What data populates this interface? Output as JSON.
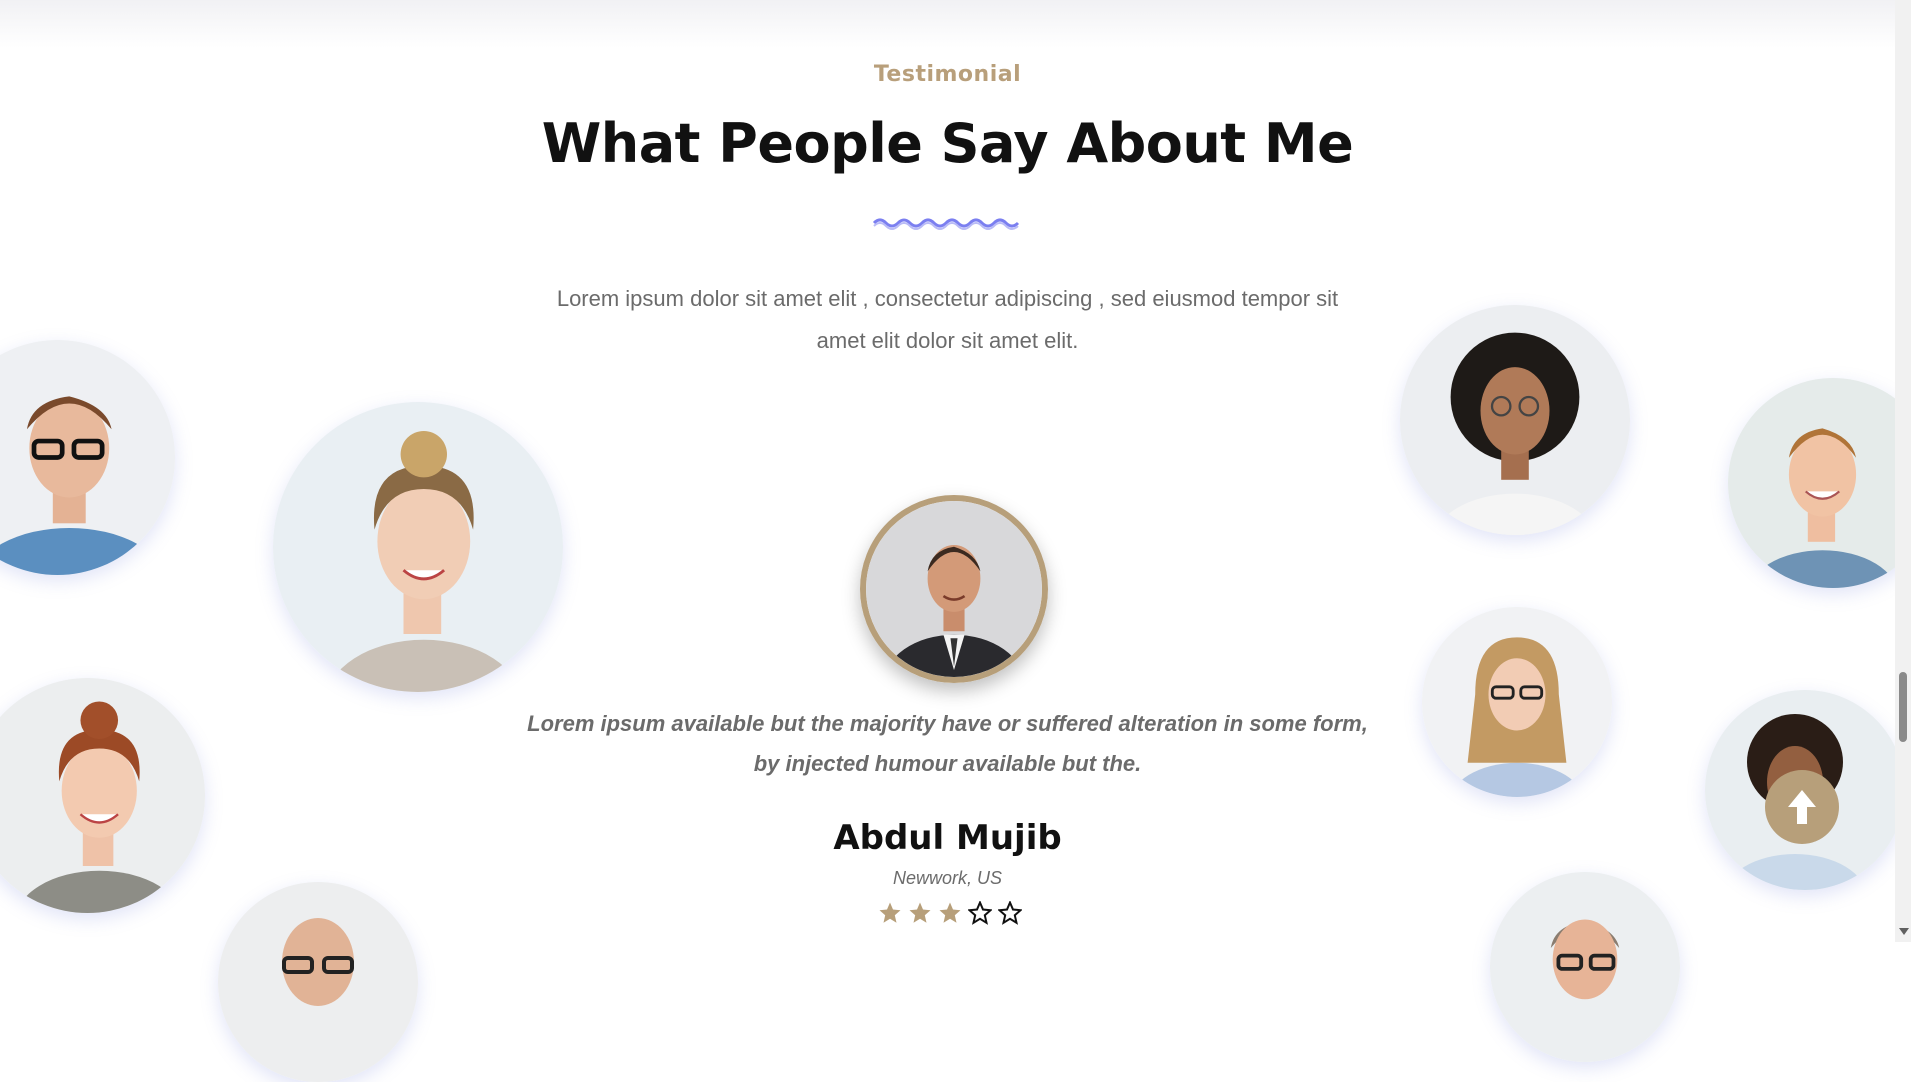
{
  "section": {
    "eyebrow": "Testimonial",
    "title": "What People Say About Me",
    "intro": "Lorem ipsum dolor sit amet elit , consectetur adipiscing , sed eiusmod tempor sit amet elit dolor sit amet elit."
  },
  "testimonial": {
    "quote": "Lorem ipsum available but the majority have or suffered alteration in some form, by injected humour available but the.",
    "name": "Abdul Mujib",
    "location": "Newwork, US",
    "rating": 3,
    "rating_max": 5
  },
  "colors": {
    "accent": "#b79f7a",
    "wave": "#7b7ff0",
    "title": "#111111",
    "body_text": "#6b6b6b"
  },
  "icons": {
    "scroll_top": "arrow-up-icon",
    "star_filled": "star-filled-icon",
    "star_empty": "star-outline-icon"
  }
}
